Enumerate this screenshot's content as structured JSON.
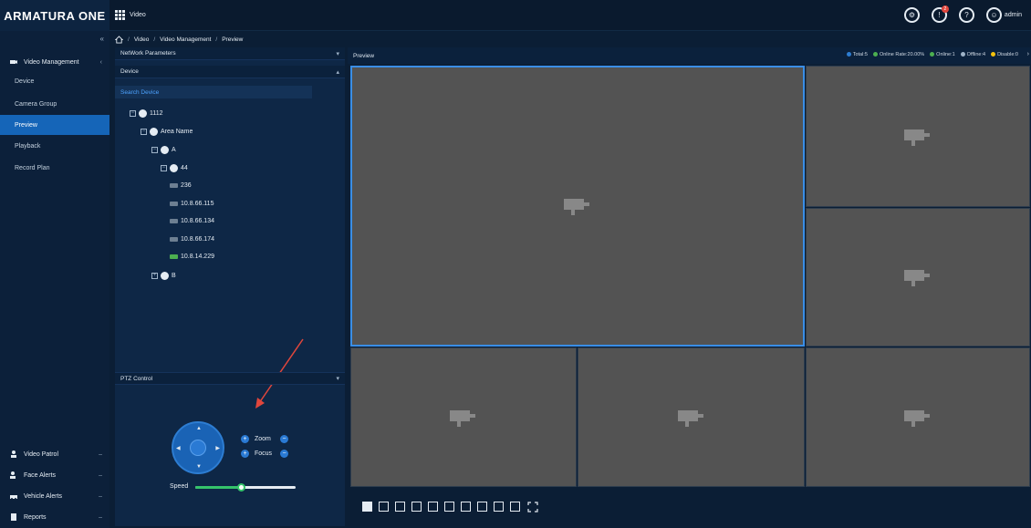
{
  "app": {
    "logo": "ARMATURA ONE",
    "module": "Video",
    "user": "admin",
    "notif_count": "2"
  },
  "breadcrumb": [
    "Video",
    "Video Management",
    "Preview"
  ],
  "sidebar": {
    "groups": [
      {
        "label": "Video Management"
      },
      {
        "label": "Video Patrol"
      },
      {
        "label": "Face Alerts"
      },
      {
        "label": "Vehicle Alerts"
      },
      {
        "label": "Reports"
      }
    ],
    "items": [
      {
        "label": "Device"
      },
      {
        "label": "Camera Group"
      },
      {
        "label": "Preview"
      },
      {
        "label": "Playback"
      },
      {
        "label": "Record Plan"
      }
    ]
  },
  "left": {
    "network_params": "NetWork Parameters",
    "device_head": "Device",
    "search_device": "Search Device",
    "tree": {
      "root": "1112",
      "area": "Area Name",
      "a": "A",
      "sub": "44",
      "cams": [
        "236",
        "10.8.66.115",
        "10.8.66.134",
        "10.8.66.174",
        "10.8.14.229"
      ],
      "b": "B"
    },
    "ptz_head": "PTZ Control",
    "zoom": "Zoom",
    "focus": "Focus",
    "speed": "Speed",
    "speed_level": 0.45
  },
  "preview": {
    "title": "Preview",
    "stats": {
      "total": "Total:5",
      "rate": "Online Rate:20.00%",
      "online": "Online:1",
      "offline": "Offline:4",
      "disable": "Disable:0"
    },
    "colors": {
      "total": "#2d7dd2",
      "online": "#4caf50",
      "offline": "#9fb3c8",
      "disable": "#f4c20d"
    }
  }
}
